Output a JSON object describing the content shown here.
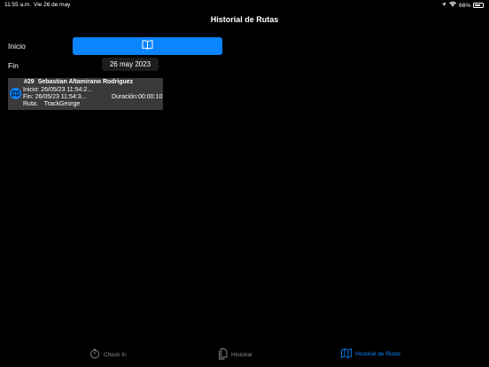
{
  "status_bar": {
    "time": "11:55 a.m.",
    "date": "Vie 26 de may",
    "battery": "66%",
    "battery_level": 0.66
  },
  "nav": {
    "title": "Historial de Rutas"
  },
  "filters": {
    "inicio_label": "Inicio",
    "fin_label": "Fin",
    "fin_date": "26 may 2023",
    "book_icon": "book-icon"
  },
  "routes": [
    {
      "number": "#29",
      "name": "Sebastian Altamirano Rodriguez",
      "inicio": "Inicio: 26/05/23 11:54:2...",
      "fin": "Fin:   26/05/23 11:54:3...",
      "duracion": "Duración:00:00:10",
      "ruta_label": "Ruta:",
      "ruta_value": "TrackGeorge",
      "icon": "route-icon"
    }
  ],
  "tabs": [
    {
      "label": "Check In",
      "icon": "stopwatch-icon",
      "active": false
    },
    {
      "label": "Historial",
      "icon": "document-icon",
      "active": false
    },
    {
      "label": "Historial de Rutas",
      "icon": "map-icon",
      "active": true
    }
  ],
  "colors": {
    "background": "#000000",
    "accent": "#0a84ff",
    "card": "#3a3a3c",
    "inactive_tab": "#8e8e93"
  }
}
